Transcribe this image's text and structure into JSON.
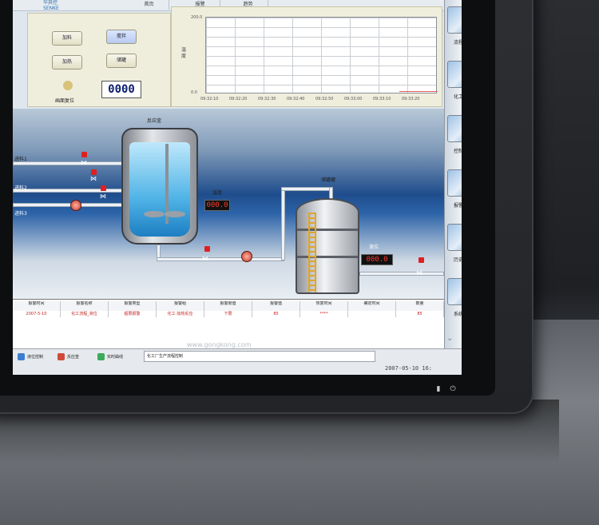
{
  "header": {
    "logo_text": "华其控",
    "logo_sub": "SENKE",
    "tabs": [
      "首页",
      "报警",
      "趋势"
    ]
  },
  "control_panel": {
    "buttons": [
      {
        "label": "加料",
        "active": false
      },
      {
        "label": "搅拌",
        "active": true
      },
      {
        "label": "加热",
        "active": false
      },
      {
        "label": "储罐",
        "active": false
      }
    ],
    "reset_label": "画面复位",
    "counter_value": "0000"
  },
  "trend": {
    "ylabel": "温度",
    "y_top": "200.0",
    "y_bottom": "0.0",
    "x_ticks": [
      "09:32:10",
      "09:32:20",
      "09:32:30",
      "09:32:40",
      "09:32:50",
      "09:33:00",
      "09:33:10",
      "09:33:20"
    ]
  },
  "process": {
    "reactor_label": "反应釜",
    "temp_label": "温度",
    "temp_display": "000.0",
    "storage_label": "储罐罐",
    "level_label": "液位",
    "level_display": "000.0",
    "inlet_labels": [
      "进料1",
      "进料2",
      "进料3"
    ]
  },
  "alarm_table": {
    "headers": [
      "报警时间",
      "报警名称",
      "报警类型",
      "报警组",
      "报警限值",
      "报警值",
      "恢复时间",
      "确定时间",
      "数量"
    ],
    "rows": [
      [
        "2007-5-10",
        "化工流程_液位",
        "超限报警",
        "化工-加热反应",
        "下限",
        "85",
        "****",
        "",
        "85"
      ]
    ],
    "watermark": "www.gongkong.com"
  },
  "status_bar": {
    "items": [
      {
        "label": "液位控制",
        "color": "#3c7ed0"
      },
      {
        "label": "反应釜",
        "color": "#d04a3c"
      },
      {
        "label": "实时曲线",
        "color": "#3cab5a"
      }
    ],
    "message": "化工厂生产流程控制",
    "datetime": "2007-05-10 16:"
  },
  "sidebar": {
    "items": [
      "流程",
      "化工",
      "控制",
      "报警",
      "历史",
      "系统"
    ]
  },
  "bezel": {
    "buttons": [
      "lock-icon",
      "power-icon"
    ]
  }
}
